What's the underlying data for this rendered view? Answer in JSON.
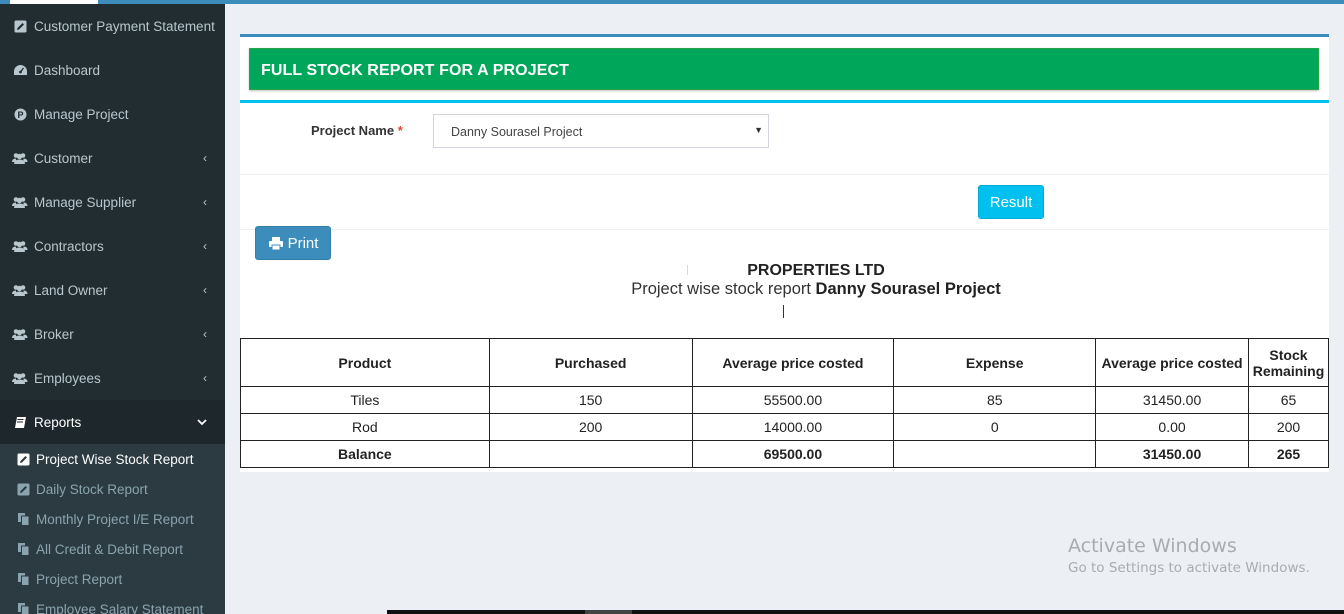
{
  "sidebar": {
    "items": [
      {
        "label": "Customer Payment Statement",
        "icon": "edit-square-icon",
        "has_chevron": false
      },
      {
        "label": "Dashboard",
        "icon": "dashboard-icon",
        "has_chevron": false
      },
      {
        "label": "Manage Project",
        "icon": "project-p-icon",
        "has_chevron": false
      },
      {
        "label": "Customer",
        "icon": "users-icon",
        "has_chevron": true
      },
      {
        "label": "Manage Supplier",
        "icon": "users-icon",
        "has_chevron": true
      },
      {
        "label": "Contractors",
        "icon": "users-icon",
        "has_chevron": true
      },
      {
        "label": "Land Owner",
        "icon": "users-icon",
        "has_chevron": true
      },
      {
        "label": "Broker",
        "icon": "users-icon",
        "has_chevron": true
      },
      {
        "label": "Employees",
        "icon": "users-icon",
        "has_chevron": true
      }
    ],
    "reports": {
      "label": "Reports",
      "icon": "book-icon",
      "chevron": "chevron-down-icon"
    },
    "sub_items": [
      {
        "label": "Project Wise Stock Report",
        "icon": "edit-square-icon",
        "active": true
      },
      {
        "label": "Daily Stock Report",
        "icon": "edit-square-icon",
        "active": false
      },
      {
        "label": "Monthly Project I/E Report",
        "icon": "copy-icon",
        "active": false
      },
      {
        "label": "All Credit & Debit Report",
        "icon": "copy-icon",
        "active": false
      },
      {
        "label": "Project Report",
        "icon": "copy-icon",
        "active": false
      },
      {
        "label": "Employee Salary Statement",
        "icon": "copy-icon",
        "active": false
      }
    ]
  },
  "header": {
    "title": "FULL STOCK REPORT FOR A PROJECT"
  },
  "form": {
    "project_label": "Project Name",
    "required_mark": "*",
    "project_value": "Danny Sourasel Project",
    "result_button": "Result"
  },
  "print_button": "Print",
  "report": {
    "company": "PROPERTIES LTD",
    "subtitle_prefix": "Project wise stock report",
    "project_name": "Danny Sourasel Project",
    "columns": [
      "Product",
      "Purchased",
      "Average price costed",
      "Expense",
      "Average price costed",
      "Stock Remaining"
    ],
    "rows": [
      [
        "Tiles",
        "150",
        "55500.00",
        "85",
        "31450.00",
        "65"
      ],
      [
        "Rod",
        "200",
        "14000.00",
        "0",
        "0.00",
        "200"
      ]
    ],
    "balance": [
      "Balance",
      "",
      "69500.00",
      "",
      "31450.00",
      "265"
    ]
  },
  "watermark": {
    "line1": "Activate Windows",
    "line2": "Go to Settings to activate Windows."
  },
  "colors": {
    "sidebar_bg": "#222d32",
    "header_green": "#00a65a",
    "accent_blue": "#3c8dbc",
    "result_cyan": "#00c0ef"
  }
}
